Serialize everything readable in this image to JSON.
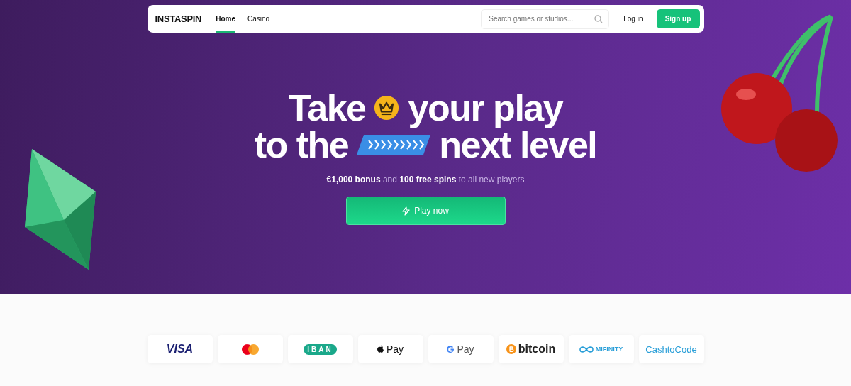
{
  "nav": {
    "logo": "INSTASPIN",
    "tabs": [
      {
        "label": "Home",
        "selected": true
      },
      {
        "label": "Casino",
        "selected": false
      }
    ],
    "search": {
      "placeholder": "Search games or studios..."
    },
    "login": "Log in",
    "signup": "Sign up"
  },
  "hero": {
    "line1_start": "Take",
    "line1_end": "your play",
    "line2_start": "to the",
    "line2_end": "next level",
    "subtitle": "**€1,000 bonus** and **100 free spins** to all new players",
    "cta": "Play now"
  },
  "payments": [
    {
      "kind": "visa",
      "text": "VISA"
    },
    {
      "kind": "mastercard"
    },
    {
      "kind": "iban",
      "text": "IBAN"
    },
    {
      "kind": "applepay",
      "text": "Pay"
    },
    {
      "kind": "googlepay",
      "text": "Pay"
    },
    {
      "kind": "bitcoin",
      "text": "bitcoin"
    },
    {
      "kind": "mifinity",
      "text": "MIFINITY"
    },
    {
      "kind": "cashtocode",
      "text": "CashtoCode"
    }
  ]
}
